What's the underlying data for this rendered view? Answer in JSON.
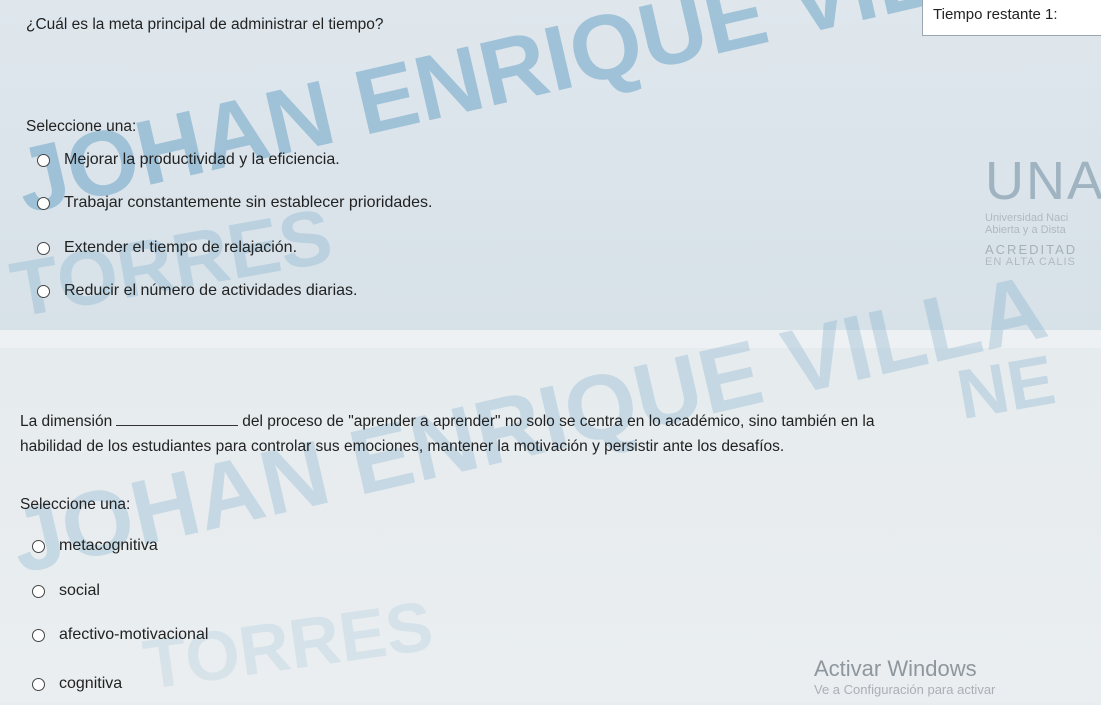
{
  "timer": {
    "label": "Tiempo restante 1:"
  },
  "question1": {
    "text": "¿Cuál es la meta principal de administrar el tiempo?",
    "select_label": "Seleccione una:",
    "options": [
      "Mejorar la productividad y la eficiencia.",
      "Trabajar constantemente sin establecer prioridades.",
      "Extender el tiempo de relajación.",
      "Reducir el número de actividades diarias."
    ]
  },
  "question2": {
    "text_before": "La dimensión",
    "text_after": "del proceso de \"aprender a aprender\" no solo se centra en lo académico, sino también en la",
    "text_line2": "habilidad de los estudiantes para controlar sus emociones, mantener la motivación y persistir ante los desafíos.",
    "select_label": "Seleccione una:",
    "options": [
      "metacognitiva",
      "social",
      "afectivo-motivacional",
      "cognitiva"
    ]
  },
  "watermarks": {
    "top_name": "JOHAN ENRIQUE VILLAF",
    "top_surname": "TORRES",
    "bottom_name": "JOHAN ENRIQUE VILLA",
    "bottom_suffix": "NE",
    "bottom_surname": "TORRES"
  },
  "logo": {
    "mark": "UNA",
    "line1": "Universidad Naci",
    "line2": "Abierta y a Dista",
    "accred1": "ACREDITAD",
    "accred2": "EN ALTA CALIS"
  },
  "os_notice": {
    "title": "Activar Windows",
    "subtitle": "Ve a Configuración para activar"
  },
  "colors": {
    "watermark": "#6fa6c8",
    "panel_top": "#dfe7ed",
    "panel_bottom": "#e6ebee"
  }
}
